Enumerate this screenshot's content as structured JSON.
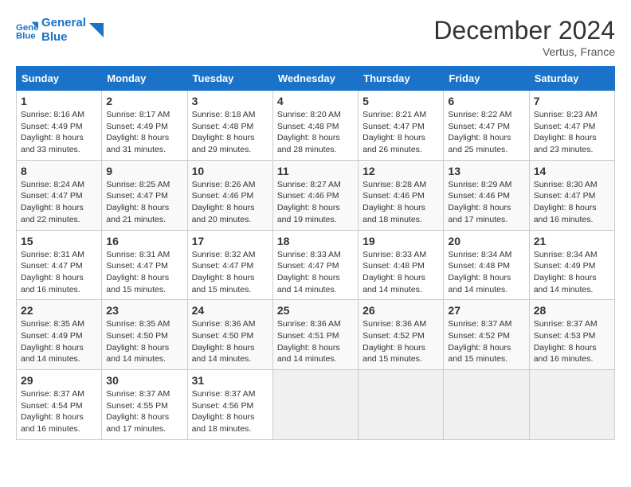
{
  "logo": {
    "line1": "General",
    "line2": "Blue"
  },
  "title": "December 2024",
  "subtitle": "Vertus, France",
  "weekdays": [
    "Sunday",
    "Monday",
    "Tuesday",
    "Wednesday",
    "Thursday",
    "Friday",
    "Saturday"
  ],
  "weeks": [
    [
      {
        "day": "1",
        "sunrise": "8:16 AM",
        "sunset": "4:49 PM",
        "daylight": "8 hours and 33 minutes."
      },
      {
        "day": "2",
        "sunrise": "8:17 AM",
        "sunset": "4:49 PM",
        "daylight": "8 hours and 31 minutes."
      },
      {
        "day": "3",
        "sunrise": "8:18 AM",
        "sunset": "4:48 PM",
        "daylight": "8 hours and 29 minutes."
      },
      {
        "day": "4",
        "sunrise": "8:20 AM",
        "sunset": "4:48 PM",
        "daylight": "8 hours and 28 minutes."
      },
      {
        "day": "5",
        "sunrise": "8:21 AM",
        "sunset": "4:47 PM",
        "daylight": "8 hours and 26 minutes."
      },
      {
        "day": "6",
        "sunrise": "8:22 AM",
        "sunset": "4:47 PM",
        "daylight": "8 hours and 25 minutes."
      },
      {
        "day": "7",
        "sunrise": "8:23 AM",
        "sunset": "4:47 PM",
        "daylight": "8 hours and 23 minutes."
      }
    ],
    [
      {
        "day": "8",
        "sunrise": "8:24 AM",
        "sunset": "4:47 PM",
        "daylight": "8 hours and 22 minutes."
      },
      {
        "day": "9",
        "sunrise": "8:25 AM",
        "sunset": "4:47 PM",
        "daylight": "8 hours and 21 minutes."
      },
      {
        "day": "10",
        "sunrise": "8:26 AM",
        "sunset": "4:46 PM",
        "daylight": "8 hours and 20 minutes."
      },
      {
        "day": "11",
        "sunrise": "8:27 AM",
        "sunset": "4:46 PM",
        "daylight": "8 hours and 19 minutes."
      },
      {
        "day": "12",
        "sunrise": "8:28 AM",
        "sunset": "4:46 PM",
        "daylight": "8 hours and 18 minutes."
      },
      {
        "day": "13",
        "sunrise": "8:29 AM",
        "sunset": "4:46 PM",
        "daylight": "8 hours and 17 minutes."
      },
      {
        "day": "14",
        "sunrise": "8:30 AM",
        "sunset": "4:47 PM",
        "daylight": "8 hours and 16 minutes."
      }
    ],
    [
      {
        "day": "15",
        "sunrise": "8:31 AM",
        "sunset": "4:47 PM",
        "daylight": "8 hours and 16 minutes."
      },
      {
        "day": "16",
        "sunrise": "8:31 AM",
        "sunset": "4:47 PM",
        "daylight": "8 hours and 15 minutes."
      },
      {
        "day": "17",
        "sunrise": "8:32 AM",
        "sunset": "4:47 PM",
        "daylight": "8 hours and 15 minutes."
      },
      {
        "day": "18",
        "sunrise": "8:33 AM",
        "sunset": "4:47 PM",
        "daylight": "8 hours and 14 minutes."
      },
      {
        "day": "19",
        "sunrise": "8:33 AM",
        "sunset": "4:48 PM",
        "daylight": "8 hours and 14 minutes."
      },
      {
        "day": "20",
        "sunrise": "8:34 AM",
        "sunset": "4:48 PM",
        "daylight": "8 hours and 14 minutes."
      },
      {
        "day": "21",
        "sunrise": "8:34 AM",
        "sunset": "4:49 PM",
        "daylight": "8 hours and 14 minutes."
      }
    ],
    [
      {
        "day": "22",
        "sunrise": "8:35 AM",
        "sunset": "4:49 PM",
        "daylight": "8 hours and 14 minutes."
      },
      {
        "day": "23",
        "sunrise": "8:35 AM",
        "sunset": "4:50 PM",
        "daylight": "8 hours and 14 minutes."
      },
      {
        "day": "24",
        "sunrise": "8:36 AM",
        "sunset": "4:50 PM",
        "daylight": "8 hours and 14 minutes."
      },
      {
        "day": "25",
        "sunrise": "8:36 AM",
        "sunset": "4:51 PM",
        "daylight": "8 hours and 14 minutes."
      },
      {
        "day": "26",
        "sunrise": "8:36 AM",
        "sunset": "4:52 PM",
        "daylight": "8 hours and 15 minutes."
      },
      {
        "day": "27",
        "sunrise": "8:37 AM",
        "sunset": "4:52 PM",
        "daylight": "8 hours and 15 minutes."
      },
      {
        "day": "28",
        "sunrise": "8:37 AM",
        "sunset": "4:53 PM",
        "daylight": "8 hours and 16 minutes."
      }
    ],
    [
      {
        "day": "29",
        "sunrise": "8:37 AM",
        "sunset": "4:54 PM",
        "daylight": "8 hours and 16 minutes."
      },
      {
        "day": "30",
        "sunrise": "8:37 AM",
        "sunset": "4:55 PM",
        "daylight": "8 hours and 17 minutes."
      },
      {
        "day": "31",
        "sunrise": "8:37 AM",
        "sunset": "4:56 PM",
        "daylight": "8 hours and 18 minutes."
      },
      null,
      null,
      null,
      null
    ]
  ],
  "labels": {
    "sunrise": "Sunrise:",
    "sunset": "Sunset:",
    "daylight": "Daylight:"
  }
}
